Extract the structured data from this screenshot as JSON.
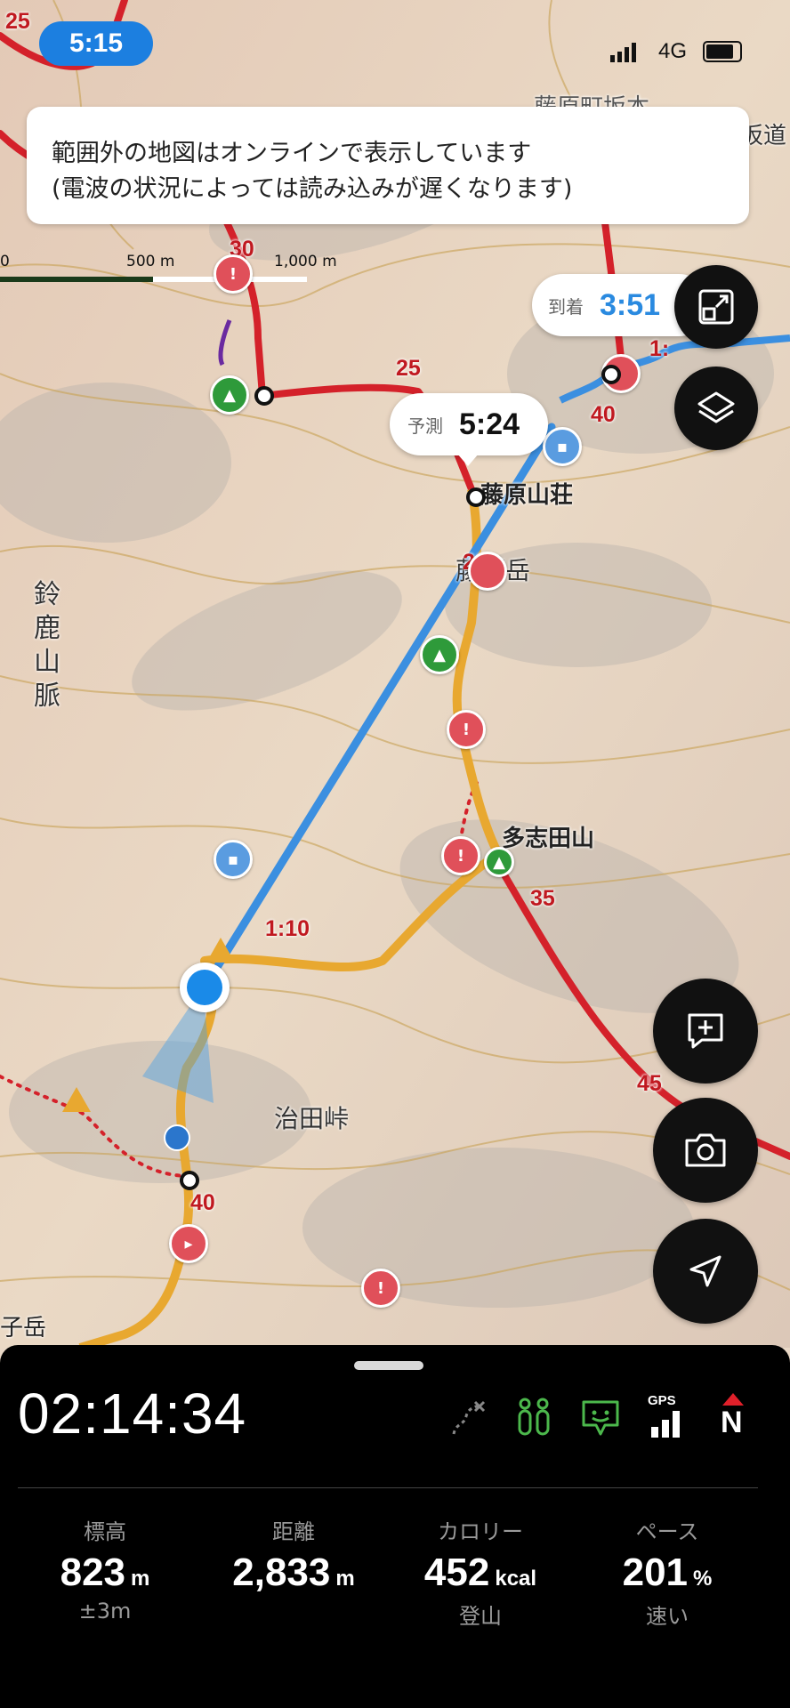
{
  "status_bar": {
    "time": "5:15",
    "network": "4G"
  },
  "notice": {
    "line1": "範囲外の地図はオンラインで表示しています",
    "line2": "(電波の状況によっては読み込みが遅くなります)"
  },
  "scale": {
    "label_start": "0",
    "label_mid": "500 m",
    "label_end": "1,000 m"
  },
  "arrival_bubble": {
    "label": "到着",
    "value": "3:51"
  },
  "forecast_bubble": {
    "label": "予測",
    "value": "5:24"
  },
  "map_labels": {
    "hut": "藤原山荘",
    "peak_fujiwara": "藤原岳",
    "peak_tashida": "多志田山",
    "range": "鈴鹿山脈",
    "pass": "治田峠",
    "peak_left": "子岳",
    "top_left_text": "藤原町坂本",
    "top_right_text": "坂道"
  },
  "route_numbers": {
    "n30": "30",
    "n25a": "25",
    "n25b": "25",
    "n20": "20",
    "n40a": "40",
    "n35": "35",
    "n45": "45",
    "n40b": "40",
    "t110": "1:10",
    "t1": "1:"
  },
  "icons": {
    "zoom_fit": "zoom-fit-icon",
    "layers": "layers-icon",
    "add_note": "add-note-icon",
    "camera": "camera-icon",
    "locate": "locate-arrow-icon"
  },
  "panel": {
    "elapsed": "02:14:34",
    "status_icons": [
      "route-off-icon",
      "companion-icon",
      "shield-face-icon",
      "gps-icon",
      "north-icon"
    ],
    "gps_label": "GPS",
    "north_label": "N",
    "stats": [
      {
        "label": "標高",
        "value": "823",
        "unit": "m",
        "sub": "±3m"
      },
      {
        "label": "距離",
        "value": "2,833",
        "unit": "m",
        "sub": ""
      },
      {
        "label": "カロリー",
        "value": "452",
        "unit": "kcal",
        "sub": "登山"
      },
      {
        "label": "ペース",
        "value": "201",
        "unit": "%",
        "sub": "速い"
      }
    ]
  },
  "colors": {
    "accent_blue": "#1c7fe0",
    "route_red": "#d4212a",
    "track_orange": "#e8a830",
    "track_blue": "#3b8fe0"
  }
}
